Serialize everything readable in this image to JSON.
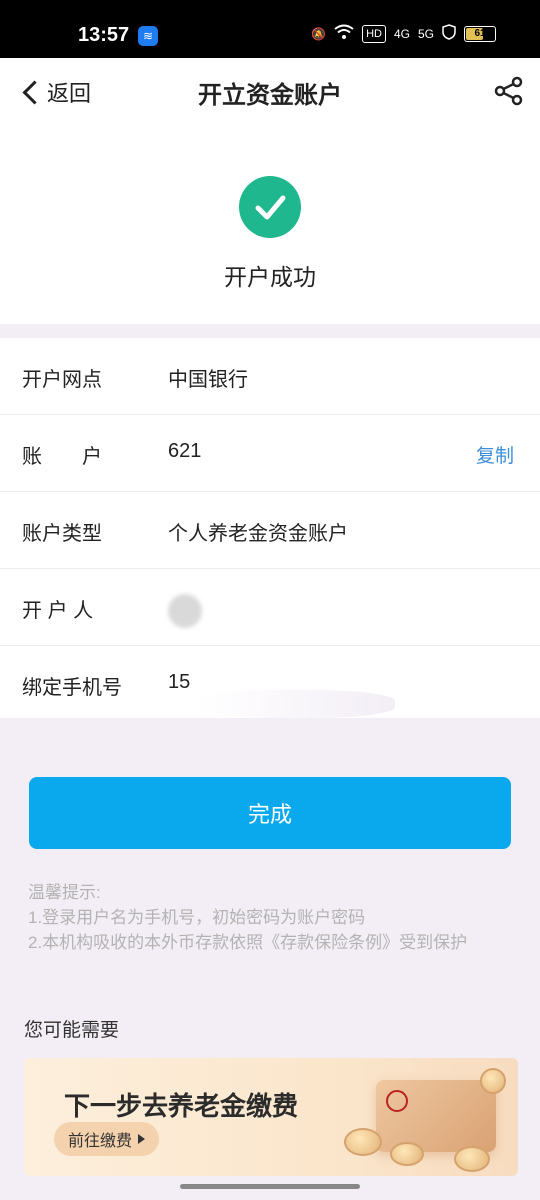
{
  "status_bar": {
    "time": "13:57",
    "network_badges": [
      "HD",
      "4G",
      "5G"
    ],
    "battery_level": "61"
  },
  "nav": {
    "back_label": "返回",
    "title": "开立资金账户"
  },
  "success": {
    "message": "开户成功"
  },
  "info": {
    "rows": [
      {
        "label": "开户网点",
        "value": "中国银行"
      },
      {
        "label": "账　　户",
        "value": "621",
        "action": "复制"
      },
      {
        "label": "账户类型",
        "value": "个人养老金资金账户"
      },
      {
        "label": "开 户 人",
        "value": ""
      },
      {
        "label": "绑定手机号",
        "value": "15"
      }
    ]
  },
  "done_button": "完成",
  "tips": {
    "title": "温馨提示:",
    "line1": "1.登录用户名为手机号，初始密码为账户密码",
    "line2": "2.本机构吸收的本外币存款依照《存款保险条例》受到保护"
  },
  "recommend": {
    "heading": "您可能需要",
    "banner_title": "下一步去养老金缴费",
    "banner_button": "前往缴费"
  },
  "colors": {
    "accent": "#0aa8ec",
    "success": "#1fb78d",
    "link": "#3b8fd9"
  }
}
